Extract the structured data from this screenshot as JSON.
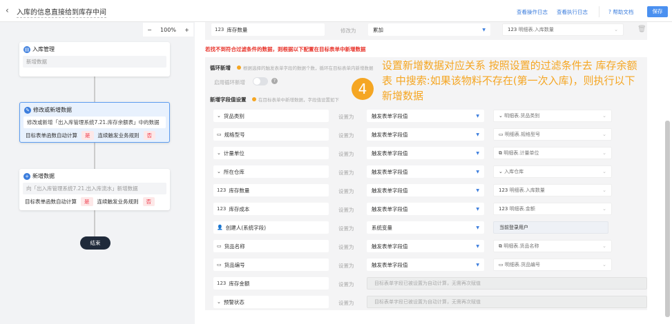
{
  "header": {
    "title": "入库的信息直接给到库存中间",
    "op_log": "查看操作日志",
    "exec_log": "查看执行日志",
    "help": "帮助文档",
    "save": "保存"
  },
  "canvas": {
    "zoom": "100%",
    "nodes": [
      {
        "title": "入库管理",
        "body": "新增数据"
      },
      {
        "title": "修改或新增数据",
        "body": "修改或新增「出入库管理系统7.21.库存余额表」中的数据",
        "calc_label": "目标表单函数自动计算",
        "calc_value": "是",
        "trigger_label": "连续触发业务规则",
        "trigger_value": "否"
      },
      {
        "title": "新增数据",
        "body": "向「出入库管理系统7.21.出入库流水」新增数据",
        "calc_label": "目标表单函数自动计算",
        "calc_value": "是",
        "trigger_label": "连续触发业务规则",
        "trigger_value": "否"
      }
    ],
    "end": "结束"
  },
  "top_row": {
    "field": "库存数量",
    "op": "修改为",
    "mode": "累加",
    "value": "明细表.入库数量"
  },
  "warning": "若找不到符合过滤条件的数据，则根据以下配置在目标表单中新增数据",
  "loop": {
    "title": "循环新增",
    "hint": "根据选择的触发表单字段的数据个数，循环在目标表单内新增数据",
    "toggle_label": "启用循环新增",
    "enabled": false
  },
  "fields_section": {
    "title": "新增字段值设置",
    "hint": "在目标表单中新增数据，字段值设置如下"
  },
  "rows": [
    {
      "icon": "⌄",
      "field": "货品类别",
      "op": "设置为",
      "mode": "触发表单字段值",
      "value_icon": "⌄",
      "value": "明细表.货品类别"
    },
    {
      "icon": "▭",
      "field": "规格型号",
      "op": "设置为",
      "mode": "触发表单字段值",
      "value_icon": "▭",
      "value": "明细表.规格型号"
    },
    {
      "icon": "⌄",
      "field": "计量单位",
      "op": "设置为",
      "mode": "触发表单字段值",
      "value_icon": "⧉",
      "value": "明细表.计量单位"
    },
    {
      "icon": "⌄",
      "field": "所在仓库",
      "op": "设置为",
      "mode": "触发表单字段值",
      "value_icon": "⌄",
      "value": "入库仓库"
    },
    {
      "icon": "123",
      "field": "库存数量",
      "op": "设置为",
      "mode": "触发表单字段值",
      "value_icon": "123",
      "value": "明细表.入库数量"
    },
    {
      "icon": "123",
      "field": "库存成本",
      "op": "设置为",
      "mode": "触发表单字段值",
      "value_icon": "123",
      "value": "明细表.金额"
    },
    {
      "icon": "👤",
      "field": "创建人(系统字段)",
      "op": "设置为",
      "mode": "系统变量",
      "value": "当前登录用户",
      "static": true
    },
    {
      "icon": "▭",
      "field": "货品名称",
      "op": "设置为",
      "mode": "触发表单字段值",
      "value_icon": "⧉",
      "value": "明细表.货品名称"
    },
    {
      "icon": "▭",
      "field": "货品编号",
      "op": "设置为",
      "mode": "触发表单字段值",
      "value_icon": "▭",
      "value": "明细表.货品编号"
    },
    {
      "icon": "123",
      "field": "库存金额",
      "op": "设置为",
      "disabled": "目标表单字段已被设置为自动计算，无需再次赋值"
    },
    {
      "icon": "⌄",
      "field": "预警状态",
      "op": "设置为",
      "disabled": "目标表单字段已被设置为自动计算，无需再次赋值"
    }
  ],
  "annotation": {
    "number": "4",
    "text": "设置新增数据对应关系 按照设置的过滤条件去 库存余额表 中搜索:如果该物料不存在(第一次入库)，则执行以下新增数据"
  },
  "colors": {
    "accent": "#3b7ddd",
    "annotation": "#f5a623",
    "warning": "#e8332a"
  }
}
